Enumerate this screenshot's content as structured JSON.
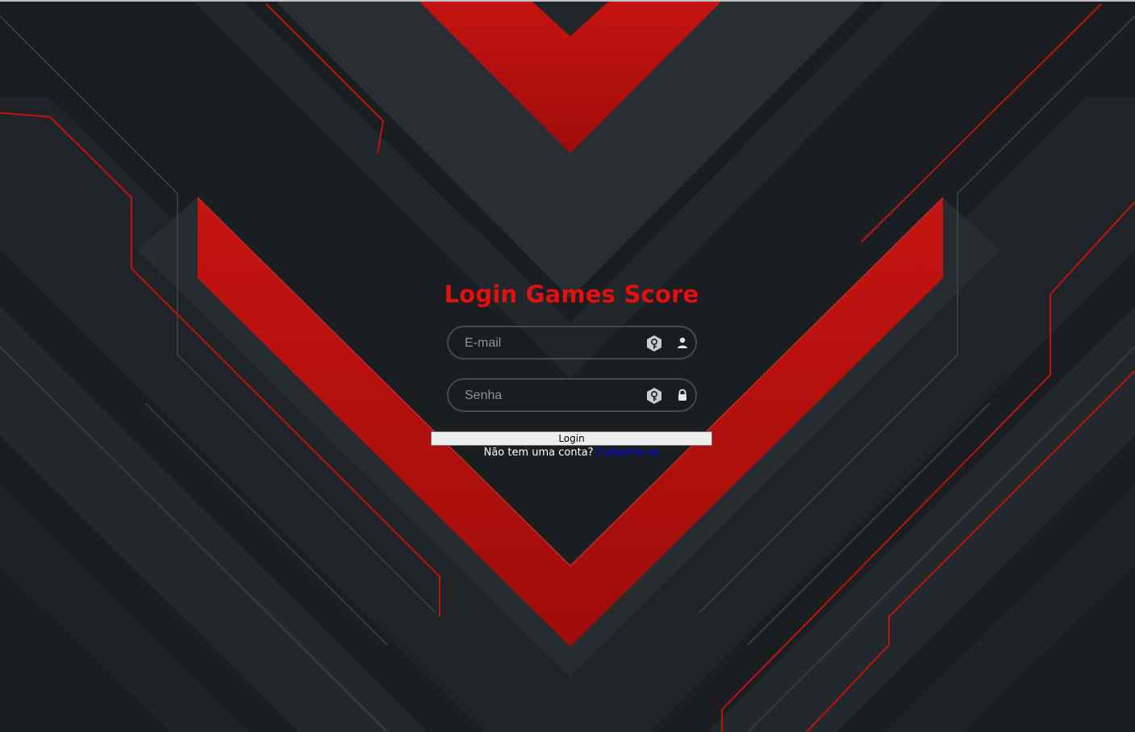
{
  "page": {
    "title": "Login Games Score"
  },
  "form": {
    "email": {
      "placeholder": "E-mail",
      "value": "",
      "icon": "user-icon"
    },
    "password": {
      "placeholder": "Senha",
      "value": "",
      "icon": "lock-icon"
    },
    "autofill_icon": "key-hexagon-icon",
    "login_label": "Login",
    "signup_prompt": "Não tem uma conta?",
    "signup_link": "Cadastre-se"
  },
  "colors": {
    "title": "#e3100d",
    "link": "#0000ee",
    "background": "#1b1f23",
    "accent_red": "#c8100f"
  }
}
